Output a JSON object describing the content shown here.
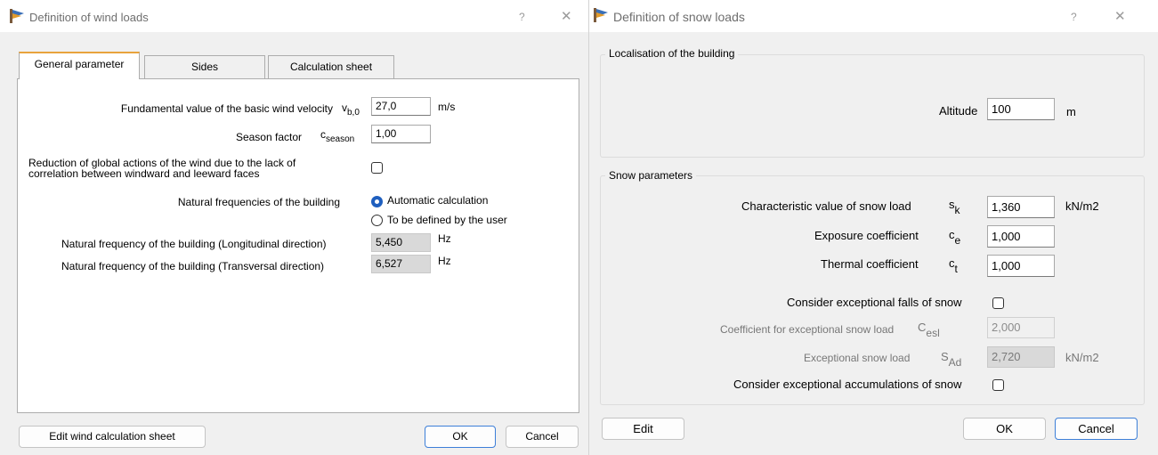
{
  "wind": {
    "title": "Definition of wind loads",
    "help": "?",
    "close": "✕",
    "tabs": [
      "General parameter",
      "Sides",
      "Calculation sheet"
    ],
    "basic_velocity": {
      "label": "Fundamental value of the basic wind velocity",
      "symbol": "v",
      "symbol_sub": "b,0",
      "value": "27,0",
      "unit": "m/s"
    },
    "season": {
      "label": "Season factor",
      "symbol": "c",
      "symbol_sub": "season",
      "value": "1,00"
    },
    "reduction": {
      "label_line1": "Reduction of global actions of the wind due to the lack of",
      "label_line2": "correlation between windward and leeward faces",
      "checked": false
    },
    "frequencies": {
      "label": "Natural frequencies of the building",
      "option_auto": "Automatic calculation",
      "option_user": "To be defined by the user",
      "selected": "auto"
    },
    "freq_long": {
      "label": "Natural frequency of the building (Longitudinal direction)",
      "value": "5,450",
      "unit": "Hz"
    },
    "freq_trans": {
      "label": "Natural frequency of the building (Transversal direction)",
      "value": "6,527",
      "unit": "Hz"
    },
    "buttons": {
      "edit_sheet": "Edit wind calculation sheet",
      "ok": "OK",
      "cancel": "Cancel"
    }
  },
  "snow": {
    "title": "Definition of snow loads",
    "help": "?",
    "close": "✕",
    "localisation": {
      "title": "Localisation of the building",
      "altitude_label": "Altitude",
      "altitude_value": "100",
      "altitude_unit": "m"
    },
    "params": {
      "title": "Snow parameters",
      "sk": {
        "label": "Characteristic value of snow load",
        "symbol": "s",
        "symbol_sub": "k",
        "value": "1,360",
        "unit": "kN/m2"
      },
      "ce": {
        "label": "Exposure coefficient",
        "symbol": "c",
        "symbol_sub": "e",
        "value": "1,000"
      },
      "ct": {
        "label": "Thermal coefficient",
        "symbol": "c",
        "symbol_sub": "t",
        "value": "1,000"
      },
      "exceptional_falls": {
        "label": "Consider exceptional falls of snow",
        "checked": false
      },
      "cesl": {
        "label": "Coefficient for exceptional snow load",
        "symbol": "C",
        "symbol_sub": "esl",
        "value": "2,000"
      },
      "sad": {
        "label": "Exceptional snow load",
        "symbol": "S",
        "symbol_sub": "Ad",
        "value": "2,720",
        "unit": "kN/m2"
      },
      "exceptional_accum": {
        "label": "Consider exceptional accumulations of snow",
        "checked": false
      }
    },
    "buttons": {
      "edit": "Edit",
      "ok": "OK",
      "cancel": "Cancel"
    }
  },
  "colors": {
    "tab_accent": "#e8a33c",
    "radio_selected": "#1f5fbf",
    "default_button_border": "#3d7fd8"
  }
}
